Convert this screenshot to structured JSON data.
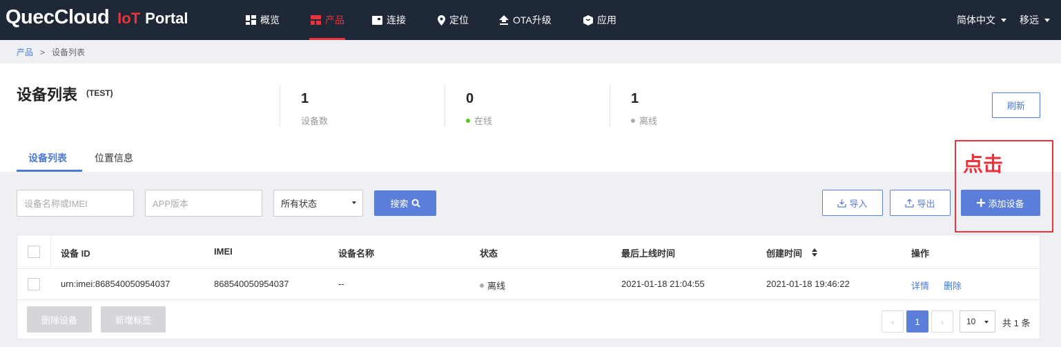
{
  "app": {
    "logo_main": "QuecCloud",
    "logo_iot": "IoT",
    "logo_portal": "Portal"
  },
  "nav": {
    "items": [
      {
        "label": "概览",
        "icon": "dashboard-icon"
      },
      {
        "label": "产品",
        "icon": "product-icon",
        "active": true
      },
      {
        "label": "连接",
        "icon": "connection-icon"
      },
      {
        "label": "定位",
        "icon": "location-pin-icon"
      },
      {
        "label": "OTA升级",
        "icon": "upload-arrow-icon"
      },
      {
        "label": "应用",
        "icon": "app-cube-icon"
      }
    ],
    "language": "简体中文",
    "user": "移远"
  },
  "breadcrumb": {
    "parent": "产品",
    "separator": ">",
    "current": "设备列表"
  },
  "header": {
    "title": "设备列表",
    "subtitle": "(TEST)",
    "stats": [
      {
        "value": "1",
        "label": "设备数"
      },
      {
        "value": "0",
        "label": "在线",
        "dot_color": "#52c41a"
      },
      {
        "value": "1",
        "label": "离线",
        "dot_color": "#aaaaaa"
      }
    ],
    "refresh_label": "刷新"
  },
  "tabs": [
    {
      "label": "设备列表",
      "active": true
    },
    {
      "label": "位置信息"
    }
  ],
  "annotation": {
    "text": "点击",
    "color": "#e8343a"
  },
  "filters": {
    "name_placeholder": "设备名称或IMEI",
    "app_version_placeholder": "APP版本",
    "status_selected": "所有状态",
    "search_label": "搜索",
    "import_label": "导入",
    "export_label": "导出",
    "add_device_label": "添加设备"
  },
  "table": {
    "columns": [
      "设备 ID",
      "IMEI",
      "设备名称",
      "状态",
      "最后上线时间",
      "创建时间",
      "操作"
    ],
    "rows": [
      {
        "device_id": "urn:imei:868540050954037",
        "imei": "868540050954037",
        "name": "--",
        "status": "离线",
        "last_online": "2021-01-18 21:04:55",
        "created": "2021-01-18 19:46:22",
        "actions": [
          "详情",
          "删除"
        ]
      }
    ]
  },
  "footer": {
    "delete_devices_label": "删除设备",
    "add_tag_label": "新增标签",
    "prev": "‹",
    "current_page": "1",
    "next": "›",
    "page_size": "10",
    "total": "共 1 条"
  },
  "colors": {
    "nav_bg": "#1f2837",
    "accent_red": "#e8343a",
    "primary_blue": "#5b7fd9",
    "link_blue": "#4a7ad6"
  }
}
